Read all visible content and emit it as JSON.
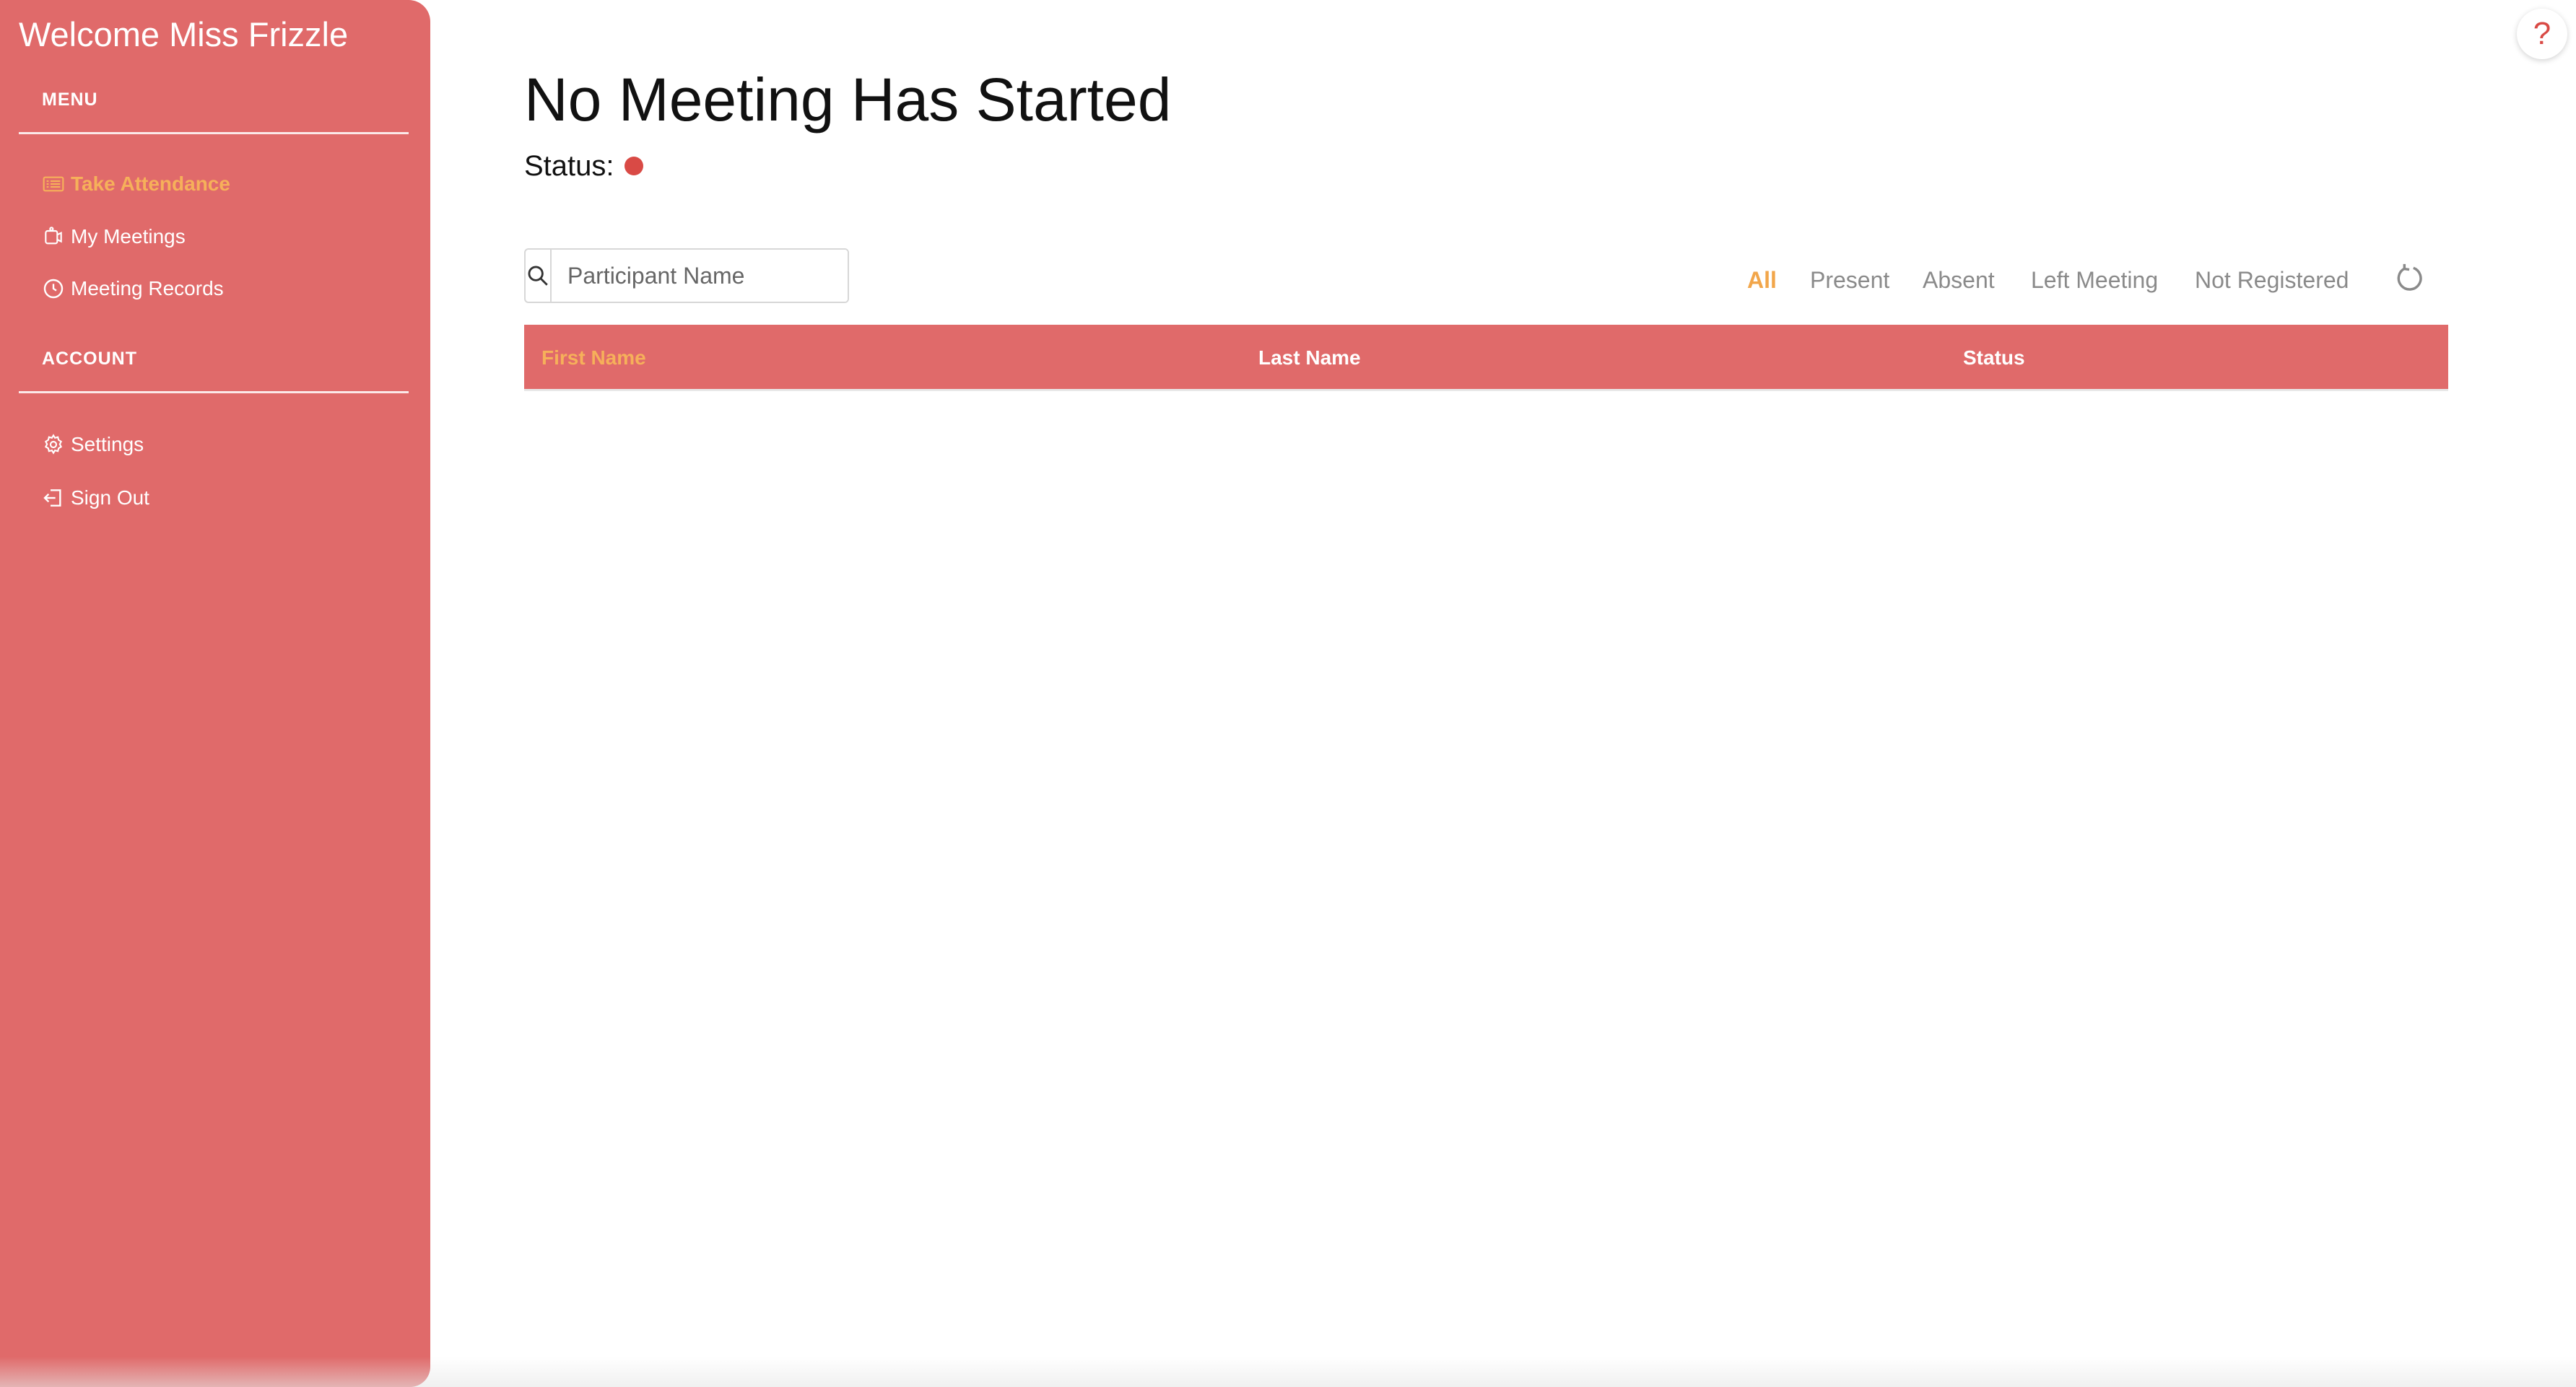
{
  "sidebar": {
    "title": "Welcome Miss Frizzle",
    "menu_label": "MENU",
    "menu_items": [
      {
        "label": "Take Attendance",
        "icon": "attendance-icon",
        "active": true
      },
      {
        "label": "My Meetings",
        "icon": "meetings-icon",
        "active": false
      },
      {
        "label": "Meeting Records",
        "icon": "clock-icon",
        "active": false
      }
    ],
    "account_label": "ACCOUNT",
    "account_items": [
      {
        "label": "Settings",
        "icon": "gear-icon"
      },
      {
        "label": "Sign Out",
        "icon": "sign-out-icon"
      }
    ],
    "background_color": "#e06a6a",
    "active_color": "#f6b05a"
  },
  "main": {
    "title": "No Meeting Has Started",
    "status_label": "Status:",
    "status_color": "#d94a45",
    "search": {
      "placeholder": "Participant Name",
      "value": ""
    },
    "filters": [
      {
        "label": "All",
        "active": true
      },
      {
        "label": "Present",
        "active": false
      },
      {
        "label": "Absent",
        "active": false
      },
      {
        "label": "Left Meeting",
        "active": false
      },
      {
        "label": "Not Registered",
        "active": false
      }
    ],
    "table": {
      "columns": [
        "First Name",
        "Last Name",
        "Status"
      ],
      "rows": []
    }
  },
  "help": {
    "label": "?"
  }
}
